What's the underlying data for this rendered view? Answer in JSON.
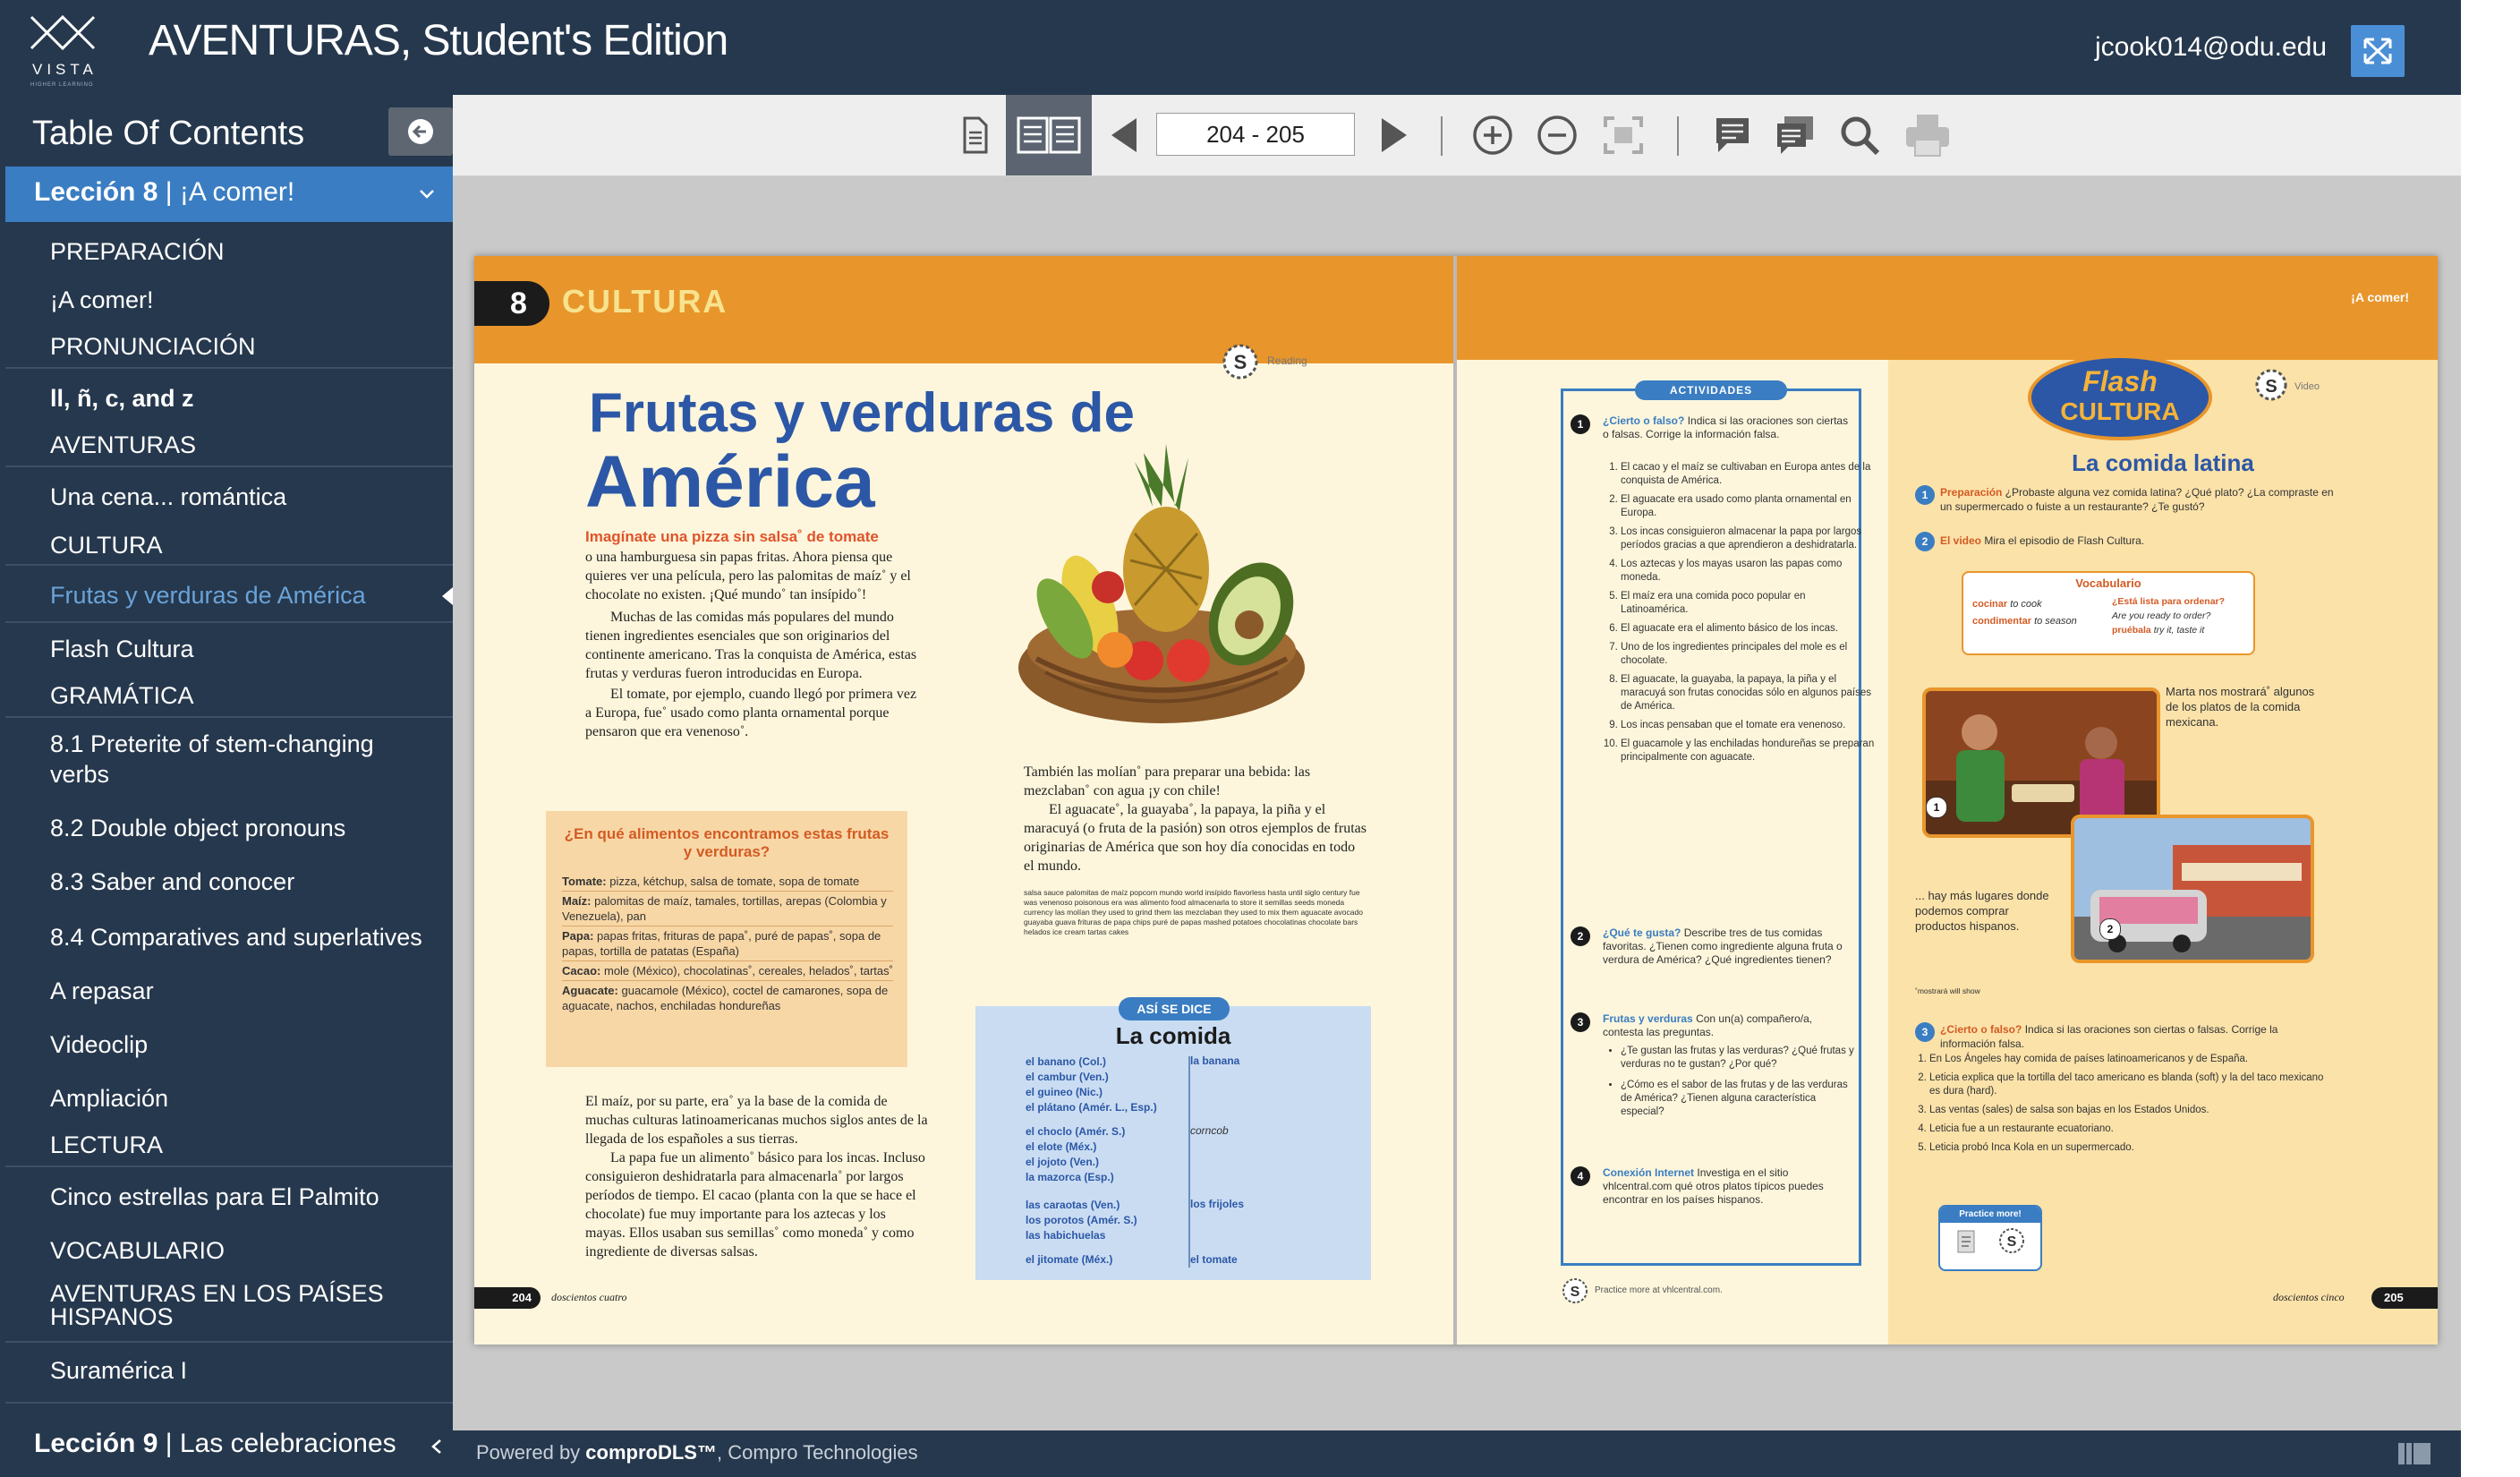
{
  "header": {
    "logo_text": "VISTA",
    "logo_subtext": "HIGHER LEARNING",
    "title": "AVENTURAS, Student's Edition",
    "user_email": "jcook014@odu.edu"
  },
  "sidebar": {
    "title": "Table Of Contents",
    "lesson_current": {
      "number": "Lección 8",
      "name": "¡A comer!"
    },
    "items": [
      {
        "label": "PREPARACIÓN",
        "type": "section"
      },
      {
        "label": "¡A comer!",
        "type": "item"
      },
      {
        "label": "PRONUNCIACIÓN",
        "type": "section"
      },
      {
        "label": "ll, ñ, c, and z",
        "type": "item",
        "bold_parts": [
          "ll, ñ, c,",
          "z"
        ]
      },
      {
        "label": "AVENTURAS",
        "type": "section"
      },
      {
        "label": "Una cena... romántica",
        "type": "item"
      },
      {
        "label": "CULTURA",
        "type": "section"
      },
      {
        "label": "Frutas y verduras de América",
        "type": "item",
        "active": true
      },
      {
        "label": "Flash Cultura",
        "type": "item"
      },
      {
        "label": "GRAMÁTICA",
        "type": "section"
      },
      {
        "label": "8.1 Preterite of stem-changing verbs",
        "type": "item"
      },
      {
        "label": "8.2 Double object pronouns",
        "type": "item"
      },
      {
        "label": "8.3 Saber and conocer",
        "type": "item"
      },
      {
        "label": "8.4 Comparatives and superlatives",
        "type": "item"
      },
      {
        "label": "A repasar",
        "type": "item"
      },
      {
        "label": "Videoclip",
        "type": "item"
      },
      {
        "label": "Ampliación",
        "type": "item"
      },
      {
        "label": "LECTURA",
        "type": "section"
      },
      {
        "label": "Cinco estrellas para El Palmito",
        "type": "item"
      },
      {
        "label": "VOCABULARIO",
        "type": "section"
      },
      {
        "label": "AVENTURAS EN LOS PAÍSES HISPANOS",
        "type": "section"
      },
      {
        "label": "Suramérica I",
        "type": "item"
      }
    ],
    "lesson_next": {
      "number": "Lección 9",
      "name": "Las celebraciones"
    }
  },
  "toolbar": {
    "page_range": "204 - 205",
    "icons": [
      "single-page-icon",
      "double-page-icon",
      "prev-page-icon",
      "next-page-icon",
      "zoom-in-icon",
      "zoom-out-icon",
      "fit-page-icon",
      "notes-icon",
      "notes-list-icon",
      "search-icon",
      "print-icon"
    ]
  },
  "book": {
    "left": {
      "lesson_number": "8",
      "section_label": "CULTURA",
      "reading_label": "Reading",
      "title_line1": "Frutas y verduras de",
      "title_line2": "América",
      "lead": "Imagínate una pizza sin salsa˚ de tomate",
      "col1_p1": "o una hamburguesa sin papas fritas. Ahora piensa que quieres ver una película, pero las palomitas de maíz˚ y el chocolate no existen. ¡Qué mundo˚ tan insípido˚!",
      "col1_p2": "Muchas de las comidas más populares del mundo tienen ingredientes esenciales que son originarios del continente americano. Tras la conquista de América, estas frutas y verduras fueron introducidas en Europa.",
      "col1_p3": "El tomate, por ejemplo, cuando llegó por primera vez a Europa, fue˚ usado como planta ornamental porque pensaron que era venenoso˚.",
      "box_title": "¿En qué alimentos encontramos estas frutas y verduras?",
      "box_items": [
        {
          "k": "Tomate:",
          "v": "pizza, kétchup, salsa de tomate, sopa de tomate"
        },
        {
          "k": "Maíz:",
          "v": "palomitas de maíz, tamales, tortillas, arepas (Colombia y Venezuela), pan"
        },
        {
          "k": "Papa:",
          "v": "papas fritas, frituras de papa˚, puré de papas˚, sopa de papas, tortilla de patatas (España)"
        },
        {
          "k": "Cacao:",
          "v": "mole (México), chocolatinas˚, cereales, helados˚, tartas˚"
        },
        {
          "k": "Aguacate:",
          "v": "guacamole (México), coctel de camarones, sopa de aguacate, nachos, enchiladas hondureñas"
        }
      ],
      "col1_p4": "El maíz, por su parte, era˚ ya la base de la comida de muchas culturas latinoamericanas muchos siglos antes de la llegada de los españoles a sus tierras.",
      "col1_p5": "La papa fue un alimento˚ básico para los incas. Incluso consiguieron deshidratarla para almacenarla˚ por largos períodos de tiempo. El cacao (planta con la que se hace el chocolate) fue muy importante para los aztecas y los mayas. Ellos usaban sus semillas˚ como moneda˚ y como ingrediente de diversas salsas.",
      "col2_p1": "También las molían˚ para preparar una bebida: las mezclaban˚ con agua ¡y con chile!",
      "col2_p2": "El aguacate˚, la guayaba˚, la papaya, la piña y el maracuyá (o fruta de la pasión) son otros ejemplos de frutas originarias de América que son hoy día conocidas en todo el mundo.",
      "glossary": "salsa sauce  palomitas de maíz popcorn  mundo world  insípido flavorless  hasta until  siglo century  fue was  venenoso poisonous  era was  alimento food  almacenarla to store it  semillas seeds  moneda currency  las molían they used to grind them  las mezclaban they used to mix them  aguacate avocado  guayaba guava  frituras de papa chips  puré de papas mashed potatoes  chocolatinas chocolate bars  helados ice cream  tartas cakes",
      "asi_se_dice_tag": "ASÍ SE DICE",
      "asi_se_dice_title": "La comida",
      "asi_groups": [
        {
          "terms": [
            "el banano (Col.)",
            "el cambur (Ven.)",
            "el guineo (Nic.)",
            "el plátano (Amér. L., Esp.)"
          ],
          "eng": "la banana"
        },
        {
          "terms": [
            "el choclo (Amér. S.)",
            "el elote (Méx.)",
            "el jojoto (Ven.)",
            "la mazorca (Esp.)"
          ],
          "eng": "corncob"
        },
        {
          "terms": [
            "las caraotas (Ven.)",
            "los porotos (Amér. S.)",
            "las habichuelas"
          ],
          "eng": "los frijoles"
        },
        {
          "terms": [
            "el jitomate (Méx.)"
          ],
          "eng": "el tomate"
        }
      ],
      "page_number": "204",
      "page_words": "doscientos cuatro"
    },
    "right": {
      "header_label": "¡A comer!",
      "actividades_tag": "ACTIVIDADES",
      "act1_title": "¿Cierto o falso?",
      "act1_instr": "Indica si las oraciones son ciertas o falsas. Corrige la información falsa.",
      "act1_items": [
        "El cacao y el maíz se cultivaban en Europa antes de la conquista de América.",
        "El aguacate era usado como planta ornamental en Europa.",
        "Los incas consiguieron almacenar la papa por largos períodos gracias a que aprendieron a deshidratarla.",
        "Los aztecas y los mayas usaron las papas como moneda.",
        "El maíz era una comida poco popular en Latinoamérica.",
        "El aguacate era el alimento básico de los incas.",
        "Uno de los ingredientes principales del mole es el chocolate.",
        "El aguacate, la guayaba, la papaya, la piña y el maracuyá son frutas conocidas sólo en algunos países de América.",
        "Los incas pensaban que el tomate era venenoso.",
        "El guacamole y las enchiladas hondureñas se preparan principalmente con aguacate."
      ],
      "act2_title": "¿Qué te gusta?",
      "act2_text": "Describe tres de tus comidas favoritas. ¿Tienen como ingrediente alguna fruta o verdura de América? ¿Qué ingredientes tienen?",
      "act3_title": "Frutas y verduras",
      "act3_text": "Con un(a) compañero/a, contesta las preguntas.",
      "act3_bullets": [
        "¿Te gustan las frutas y las verduras? ¿Qué frutas y verduras no te gustan? ¿Por qué?",
        "¿Cómo es el sabor de las frutas y de las verduras de América? ¿Tienen alguna característica especial?"
      ],
      "act4_title": "Conexión Internet",
      "act4_text": "Investiga en el sitio vhlcentral.com qué otros platos típicos puedes encontrar en los países hispanos.",
      "practice_note": "Practice more at vhlcentral.com.",
      "flash_logo_top": "Flash",
      "flash_logo_bottom": "CULTURA",
      "video_label": "Video",
      "fc_title": "La comida latina",
      "fc1_title": "Preparación",
      "fc1_text": "¿Probaste alguna vez comida latina? ¿Qué plato? ¿La compraste en un supermercado o fuiste a un restaurante? ¿Te gustó?",
      "fc2_title": "El video",
      "fc2_text": "Mira el episodio de Flash Cultura.",
      "vocab_title": "Vocabulario",
      "vocab_left": [
        {
          "es": "cocinar",
          "en": "to cook"
        },
        {
          "es": "condimentar",
          "en": "to season"
        }
      ],
      "vocab_right": [
        {
          "es": "¿Está lista para ordenar?",
          "en": "Are you ready to order?"
        },
        {
          "es": "pruébala",
          "en": "try it, taste it"
        }
      ],
      "photo1_caption": "Marta nos mostrará˚ algunos de los platos de la comida mexicana.",
      "photo2_caption": "... hay más lugares donde podemos comprar productos hispanos.",
      "mostrara_note": "˚mostrará will show",
      "fc3_title": "¿Cierto o falso?",
      "fc3_text": "Indica si las oraciones son ciertas o falsas. Corrige la información falsa.",
      "fc3_items": [
        "En Los Ángeles hay comida de países latinoamericanos y de España.",
        "Leticia explica que la tortilla del taco americano es blanda (soft) y la del taco mexicano es dura (hard).",
        "Las ventas (sales) de salsa son bajas en los Estados Unidos.",
        "Leticia fue a un restaurante ecuatoriano.",
        "Leticia probó Inca Kola en un supermercado."
      ],
      "practice_more": "Practice more!",
      "page_number": "205",
      "page_words": "doscientos cinco"
    }
  },
  "footer": {
    "powered_prefix": "Powered by ",
    "powered_brand": "comproDLS™",
    "powered_suffix": ", Compro Technologies"
  },
  "colors": {
    "header_bg": "#26384d",
    "accent_blue": "#3a7dc2",
    "orange": "#e8962c",
    "title_blue": "#2c57a6",
    "page_bg": "#fdf6dc"
  }
}
